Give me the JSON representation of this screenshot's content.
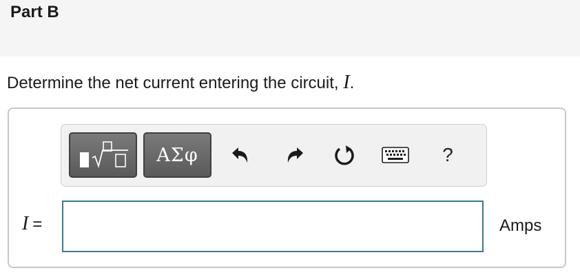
{
  "part": {
    "title": "Part B"
  },
  "question": {
    "text": "Determine the net current entering the circuit, ",
    "variable": "I",
    "end": "."
  },
  "toolbar": {
    "templates_icon": "templates-sqrt-icon",
    "symbols_label": "ΑΣφ",
    "undo_icon": "undo-icon",
    "redo_icon": "redo-icon",
    "reset_icon": "reset-icon",
    "keyboard_icon": "keyboard-icon",
    "help_label": "?"
  },
  "answer": {
    "variable": "I",
    "equals": "=",
    "value": "",
    "units": "Amps"
  },
  "colors": {
    "header_bg": "#f5f5f5",
    "input_border": "#3a7a8c",
    "button_dark": "#5a5a5a"
  }
}
